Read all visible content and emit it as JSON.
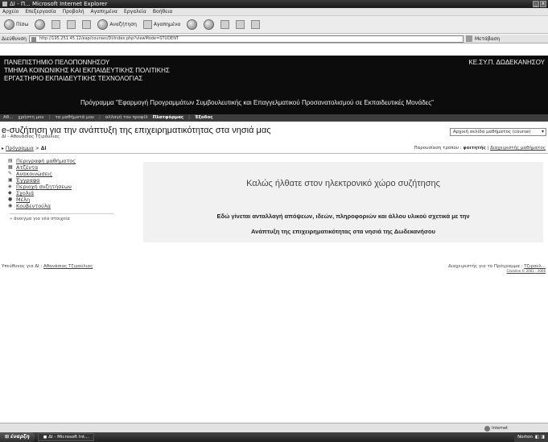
{
  "window": {
    "title": "ΔΙ - Π...  Microsoft Internet Explorer",
    "min": "_",
    "close": "x"
  },
  "menu": [
    "Αρχείο",
    "Επεξεργασία",
    "Προβολή",
    "Αγαπημένα",
    "Εργαλεία",
    "Βοήθεια"
  ],
  "toolbar": {
    "back": "Πίσω",
    "search": "Αναζήτηση",
    "favorites": "Αγαπημένα"
  },
  "address": {
    "label": "Διεύθυνση",
    "url": "http://195.251.45.12/eap/courses/DI/index.php?viewMode=STUDENT",
    "links": "Μετάβαση"
  },
  "banner": {
    "inst_line1": "ΠΑΝΕΠΙΣΤΗΜΙΟ ΠΕΛΟΠΟΝΝΗΣΟΥ",
    "inst_line2": "ΤΜΗΜΑ ΚΟΙΝΩΝΙΚΗΣ ΚΑΙ ΕΚΠΑΙΔΕΥΤΙΚΗΣ ΠΟΛΙΤΙΚΗΣ",
    "inst_line3": "ΕΡΓΑΣΤΗΡΙΟ ΕΚΠΑΙΔΕΥΤΙΚΗΣ ΤΕΧΝΟΛΟΓΙΑΣ",
    "right": "ΚΕ.ΣΥ.Π. ΔΩΔΕΚΑΝΗΣΟΥ",
    "program": "Πρόγραμμα \"Εφαρμογή Προγραμμάτων Συμβουλευτικής και Επαγγελματικού Προσανατολισμού σε Εκπαιδευτικές Μονάδες\""
  },
  "nav": {
    "user": "Αθ...",
    "items": [
      "χρήστη μου",
      "τα μαθήματά μου",
      "αλλαγή του προφίλ",
      "Πλατφόρμας",
      "Έξοδος"
    ]
  },
  "course": {
    "title": "e-συζήτηση για την ανάπτυξη της επιχειρηματικότητας στα νησιά μας",
    "subtitle": "ΔΙ - Αθανάσιος Τζιρούλιας",
    "select": "Αρχική σελίδα μαθήματος (course)"
  },
  "breadcrumb": {
    "home": "Πρόγραμμα",
    "sep": ">",
    "current": "ΔΙ"
  },
  "view_mode": {
    "label": "Παρουσίαση τρόπου :",
    "student": "φοιτητής",
    "sep": "|",
    "admin": "Διαχειριστής μαθήματος"
  },
  "sidebar": {
    "items": [
      {
        "icon": "▤",
        "label": "Περιγραφή μαθήματος"
      },
      {
        "icon": "▦",
        "label": "Ατζέντα"
      },
      {
        "icon": "✎",
        "label": "Ανακοινώσεις"
      },
      {
        "icon": "▣",
        "label": "Έγγραφα"
      },
      {
        "icon": "◈",
        "label": "Περιοχή συζητήσεων"
      },
      {
        "icon": "◆",
        "label": "Σχολιά"
      },
      {
        "icon": "●",
        "label": "Μέλη"
      },
      {
        "icon": "◉",
        "label": "Κουβεντούλα"
      }
    ],
    "hide": "» άνοιγμα για νέα στοιχεία"
  },
  "welcome": {
    "title": "Καλώς ήλθατε στον ηλεκτρονικό χώρο συζήτησης",
    "line1": "Εδώ γίνεται ανταλλαγή απόψεων, ιδεών, πληροφοριών και άλλου υλικού σχετικά με την",
    "line2": "Ανάπτυξη της επιχειρηματικότητας στα νησιά της Δωδεκανήσου"
  },
  "footer": {
    "left_prefix": "Υπεύθυνος για ΔΙ :",
    "left_name": "Αθανάσιος Τζιρούλιας",
    "right_prefix": "Διαχειριστής για το Πρόγραμμα :",
    "right_name": "Τζιρούλ...",
    "right_small": "Claroline © 2001 - 2006"
  },
  "status": {
    "zone": "Internet"
  },
  "taskbar": {
    "start": "έναρξη",
    "task": "ΔΙ - Microsoft Int...",
    "tray": "Norton"
  }
}
